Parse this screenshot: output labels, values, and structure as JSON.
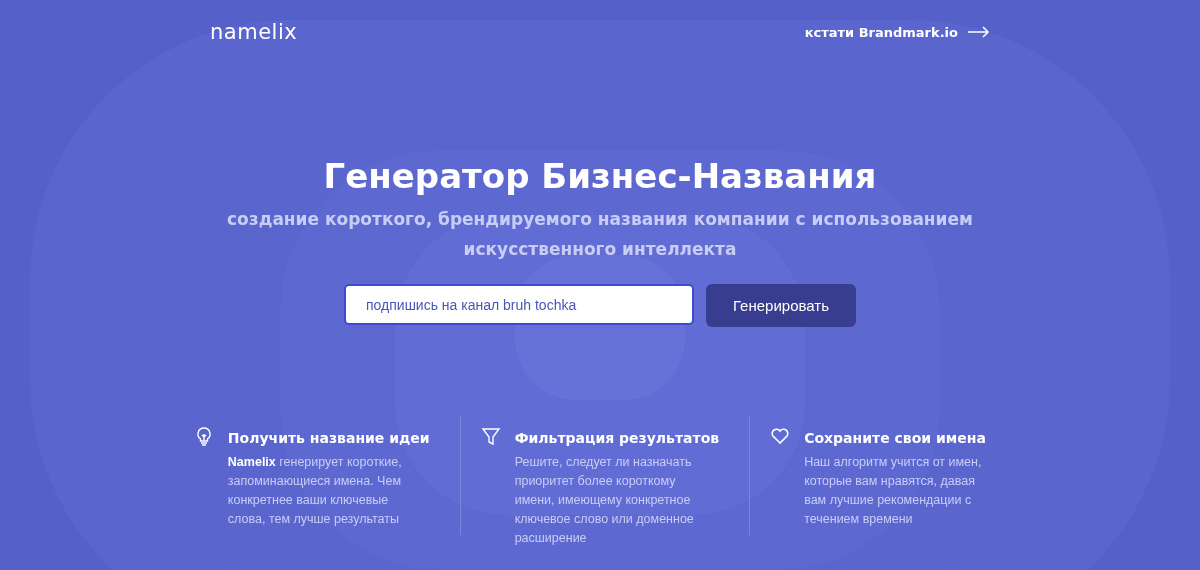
{
  "header": {
    "logo": "namelix",
    "link": "кстати Brandmark.io"
  },
  "hero": {
    "title": "Генератор Бизнес-Названия",
    "subtitle": "создание короткого, брендируемого названия компании с использованием искусственного интеллекта",
    "input": {
      "value": "подпишись на канал bruh tochka"
    },
    "button": "Генерировать"
  },
  "features": [
    {
      "kind": "bulb",
      "title": "Получить название идеи",
      "text": "**Namelix** генерирует короткие, запоминающиеся имена. Чем конкретнее ваши ключевые слова, тем лучше результаты"
    },
    {
      "kind": "filter",
      "title": "Фильтрация результатов",
      "text": "Решите, следует ли назначать приоритет более короткому имени, имеющему конкретное ключевое слово или доменное расширение"
    },
    {
      "kind": "heart",
      "title": "Сохраните свои имена",
      "text": "Наш алгоритм учится от имен, которые вам нравятся, давая вам лучшие рекомендации с течением времени"
    }
  ]
}
